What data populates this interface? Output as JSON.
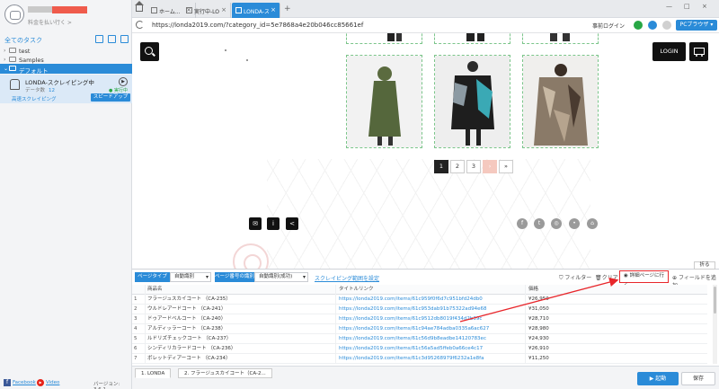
{
  "sidebar": {
    "user_sub": "料金を払い行く >",
    "tasks_label": "全てのタスク",
    "tree": [
      {
        "arrow": "›",
        "label": "test"
      },
      {
        "arrow": "›",
        "label": "Samples"
      },
      {
        "arrow": "⌄",
        "label": "デフォルト"
      }
    ],
    "task": {
      "name": "LONDA-スクレイピング中",
      "count_label": "データ数",
      "count": "12",
      "status": "● 実行中",
      "mode": "高速スクレイピング",
      "speed_button": "スピードアップ",
      "play": "▶"
    },
    "footer": {
      "facebook": "Facebook",
      "video": "Video",
      "version": "バージョン: 3.6.1"
    }
  },
  "tabs": [
    {
      "label": "ホーム...",
      "close": "×"
    },
    {
      "label": "実行中-LO...",
      "close": "×"
    },
    {
      "label": "LONDA-ス...",
      "close": "×"
    }
  ],
  "tab_add": "+",
  "window_controls": [
    "—",
    "□",
    "×"
  ],
  "address": {
    "url": "https://londa2019.com/?category_id=5e7868a4e20b046cc85661ef",
    "pre_login": "事前ログイン",
    "browser_mode": "PCブラウザ ▾",
    "icon_colors": [
      "#28a745",
      "#2a8bd8",
      "#d0d0d0"
    ]
  },
  "site": {
    "login": "LOGIN",
    "pagination": [
      "1",
      "2",
      "3",
      "›",
      "»"
    ],
    "current_page": "1",
    "footer_icons": [
      "mail-icon",
      "info-icon",
      "share-icon"
    ],
    "footer_glyphs": [
      "✉",
      "i",
      "<"
    ],
    "social_icons": [
      "facebook-icon",
      "twitter-icon",
      "instagram-icon",
      "line-icon",
      "home-icon"
    ],
    "social_glyphs": [
      "f",
      "t",
      "◎",
      "•",
      "⌂"
    ]
  },
  "panel": {
    "page_type_label": "ページタイプ",
    "page_type_value": "自動識別",
    "page_num_label": "ページ番号の識別",
    "page_num_value": "自動識別(成功)",
    "range_link": "スクレイピング範囲を設定",
    "filter": "フィルター",
    "clear": "クリア",
    "detail_button": "詳細ページに行く",
    "add_field": "フィールドを追加",
    "fold": "折る",
    "columns": [
      "",
      "商品名",
      "タイトルリンク",
      "価格"
    ],
    "rows": [
      [
        "1",
        "フラージュスカイコート （CA-235）",
        "https://londa2019.com/items/61c959f0f6d7c951bfd24db0",
        "¥26,950"
      ],
      [
        "2",
        "ウルドレアードコート （CA-241）",
        "https://londa2019.com/items/61c953dab91b75322ad94e68",
        "¥31,050"
      ],
      [
        "3",
        "ドゥアードベルコート （CA-240）",
        "https://londa2019.com/items/61c9512db8019f434d2b39c",
        "¥28,710"
      ],
      [
        "4",
        "アルディッラーコート （CA-238）",
        "https://londa2019.com/items/61c94ae784adba0335a6ac627",
        "¥28,980"
      ],
      [
        "5",
        "ルドリズチェックコート （CA-237）",
        "https://londa2019.com/items/61c56d9b8eadbe14120783ec",
        "¥24,930"
      ],
      [
        "6",
        "シンディリカラードコート （CA-236）",
        "https://londa2019.com/items/61c56a5ad5ffeb0a66ce4c17",
        "¥26,910"
      ],
      [
        "7",
        "ボレットディアーコート （CA-234）",
        "https://londa2019.com/items/61c3d95268979f6232a1e8fa",
        "¥11,250"
      ]
    ]
  },
  "bottom": {
    "tabs": [
      "1. LONDA",
      "2. フラージュスカイコート（CA-2..."
    ],
    "run": "▶ 起動",
    "save": "保存"
  },
  "accent": "#2a8bd8",
  "highlight": "#e8262b"
}
